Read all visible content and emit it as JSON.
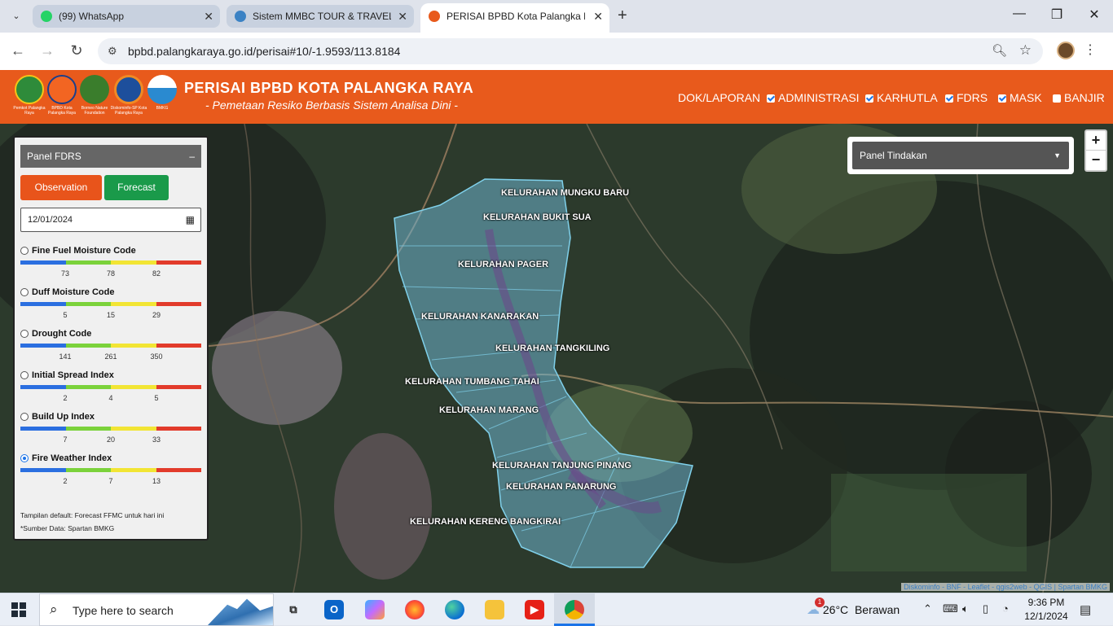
{
  "browser": {
    "tabs": [
      {
        "title": "(99) WhatsApp",
        "favicon_color": "#25d366",
        "active": false
      },
      {
        "title": "Sistem MMBC TOUR & TRAVEL",
        "favicon_color": "#3b82c4",
        "active": false
      },
      {
        "title": "PERISAI BPBD Kota Palangka Ra",
        "favicon_color": "#e85a1c",
        "active": true
      }
    ],
    "url": "bpbd.palangkaraya.go.id/perisai#10/-1.9593/113.8184"
  },
  "header": {
    "logo_captions": [
      "Pemkot Palangka Raya",
      "BPBD Kota Palangka Raya",
      "Borneo Nature Foundation",
      "Diskominfo-SP Kota Palangka Raya",
      "BMKG"
    ],
    "title": "PERISAI BPBD KOTA PALANGKA RAYA",
    "subtitle": "- Pemetaan Resiko Berbasis Sistem Analisa Dini -",
    "menu": {
      "dok": "DOK/LAPORAN",
      "administrasi": "ADMINISTRASI",
      "karhutla": "KARHUTLA",
      "fdrs": "FDRS",
      "mask": "MASK",
      "banjir": "BANJIR"
    }
  },
  "map": {
    "zoom_in": "+",
    "zoom_out": "−",
    "panel_tindakan": "Panel Tindakan",
    "attribution": "Diskominfo - BNF - Leaflet - qgis2web - QGIS | Spartan BMKG",
    "regions": [
      "KELURAHAN MUNGKU BARU",
      "KELURAHAN BUKIT SUA",
      "KELURAHAN PAGER",
      "KELURAHAN KANARAKAN",
      "KELURAHAN TANGKILING",
      "KELURAHAN TUMBANG TAHAI",
      "KELURAHAN MARANG",
      "KELURAHAN TANJUNG PINANG",
      "KELURAHAN PANARUNG",
      "KELURAHAN KERENG BANGKIRAI"
    ]
  },
  "panel_fdrs": {
    "title": "Panel FDRS",
    "minimize": "–",
    "observation": "Observation",
    "forecast": "Forecast",
    "date": "12/01/2024",
    "indices": [
      {
        "name": "Fine Fuel Moisture Code",
        "ticks": [
          "73",
          "78",
          "82"
        ],
        "selected": false
      },
      {
        "name": "Duff Moisture Code",
        "ticks": [
          "5",
          "15",
          "29"
        ],
        "selected": false
      },
      {
        "name": "Drought Code",
        "ticks": [
          "141",
          "261",
          "350"
        ],
        "selected": false
      },
      {
        "name": "Initial Spread Index",
        "ticks": [
          "2",
          "4",
          "5"
        ],
        "selected": false
      },
      {
        "name": "Build Up Index",
        "ticks": [
          "7",
          "20",
          "33"
        ],
        "selected": false
      },
      {
        "name": "Fire Weather Index",
        "ticks": [
          "2",
          "7",
          "13"
        ],
        "selected": true
      }
    ],
    "scale_colors": [
      "#2b6fe0",
      "#7bd23b",
      "#f2e534",
      "#e23b2b"
    ],
    "note_default": "Tampilan default: Forecast FFMC untuk hari ini",
    "note_source": "*Sumber Data: Spartan BMKG"
  },
  "taskbar": {
    "search_placeholder": "Type here to search",
    "weather_badge": "1",
    "weather": "26°C  Berawan",
    "time": "9:36 PM",
    "date": "12/1/2024"
  }
}
